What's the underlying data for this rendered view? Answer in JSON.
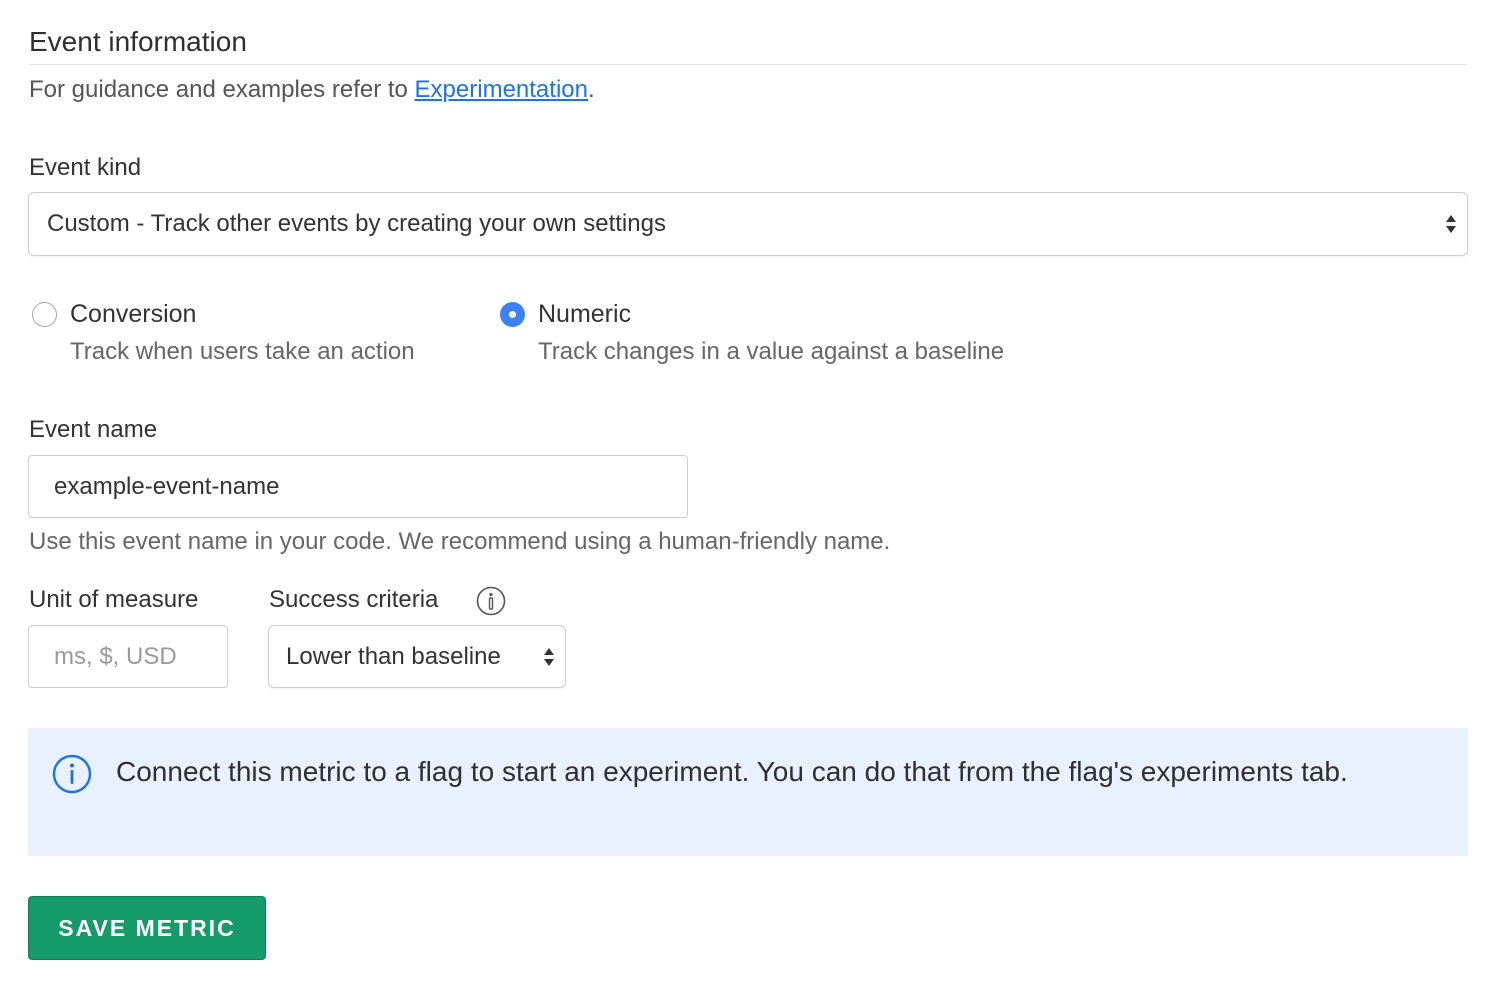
{
  "section": {
    "title": "Event information",
    "guidance_prefix": "For guidance and examples refer to ",
    "guidance_link": "Experimentation",
    "guidance_suffix": "."
  },
  "event_kind": {
    "label": "Event kind",
    "selected": "Custom - Track other events by creating your own settings"
  },
  "metric_type": {
    "options": [
      {
        "label": "Conversion",
        "description": "Track when users take an action",
        "checked": false
      },
      {
        "label": "Numeric",
        "description": "Track changes in a value against a baseline",
        "checked": true
      }
    ]
  },
  "event_name": {
    "label": "Event name",
    "value": "example-event-name",
    "hint": "Use this event name in your code. We recommend using a human-friendly name."
  },
  "unit_of_measure": {
    "label": "Unit of measure",
    "placeholder": "ms, $, USD",
    "value": ""
  },
  "success_criteria": {
    "label": "Success criteria",
    "selected": "Lower than baseline"
  },
  "callout": {
    "text": "Connect this metric to a flag to start an experiment. You can do that from the flag's experiments tab."
  },
  "actions": {
    "save_label": "SAVE METRIC"
  },
  "colors": {
    "primary_button": "#159a6c",
    "link": "#1a73e8",
    "radio_checked": "#3b82f6",
    "callout_bg": "#e8f1fd"
  }
}
